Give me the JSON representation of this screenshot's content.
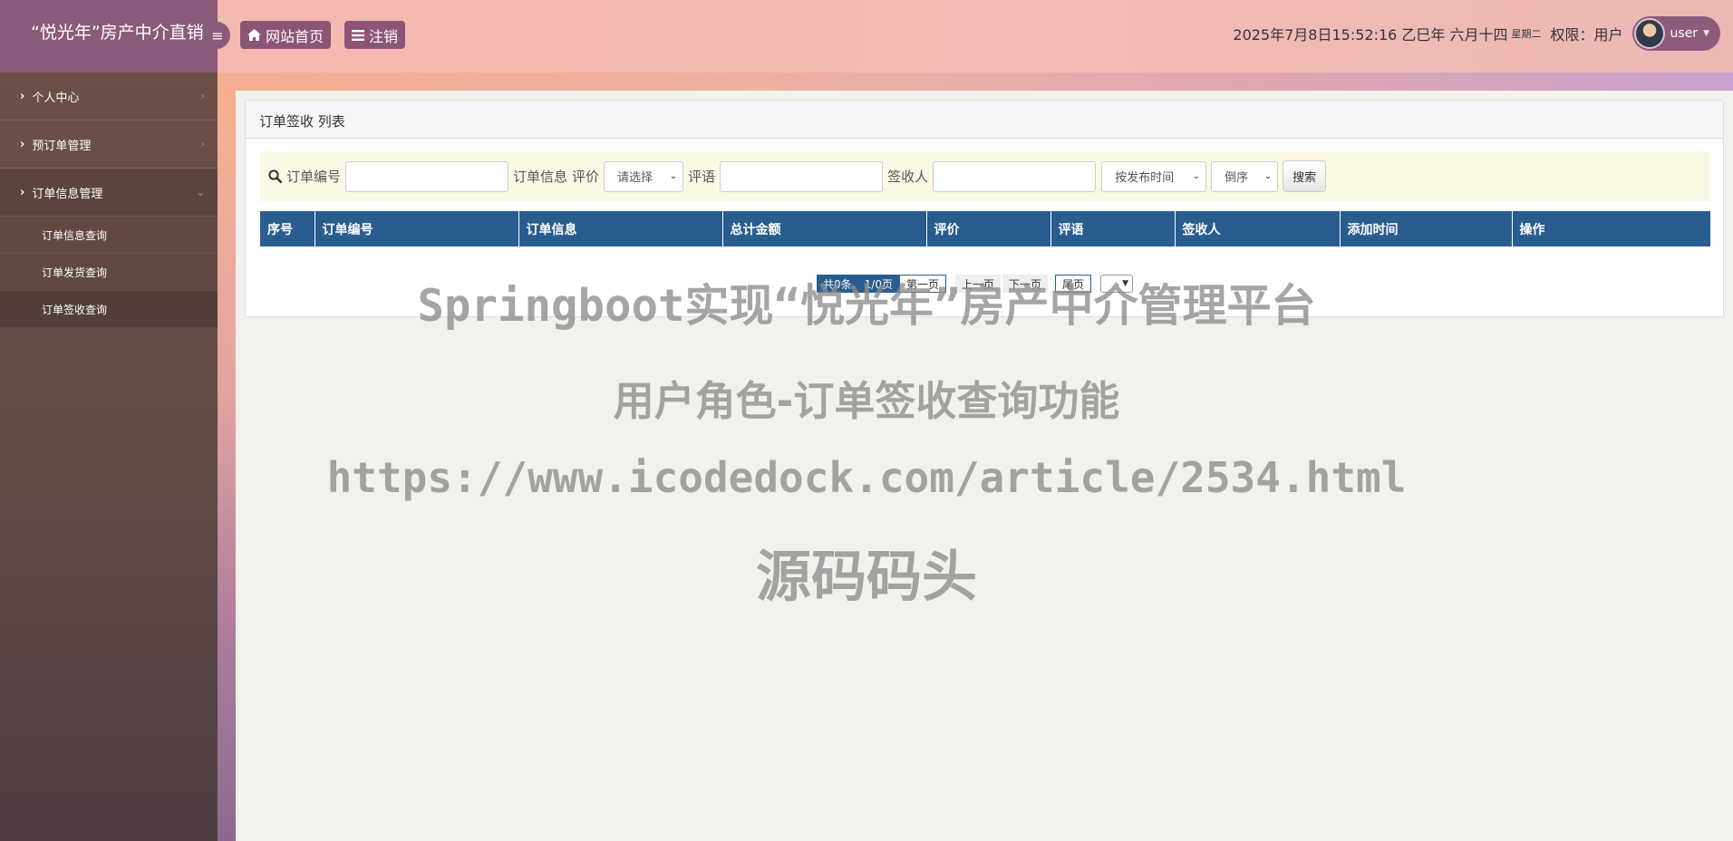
{
  "header": {
    "brand": "“悦光年”房产中介直销",
    "home_label": "网站首页",
    "logout_label": "注销",
    "datetime": "2025年7月8日15:52:16 乙巳年 六月十四",
    "weekday": "星期二",
    "permission": "权限：用户",
    "username": "user"
  },
  "sidebar": {
    "items": [
      {
        "label": "个人中心",
        "expanded": false
      },
      {
        "label": "预订单管理",
        "expanded": false
      },
      {
        "label": "订单信息管理",
        "expanded": true
      }
    ],
    "subitems": [
      {
        "label": "订单信息查询"
      },
      {
        "label": "订单发货查询"
      },
      {
        "label": "订单签收查询",
        "active": true
      }
    ]
  },
  "panel": {
    "title": "订单签收 列表"
  },
  "search": {
    "order_no_label": "订单编号",
    "order_info_label": "订单信息",
    "rating_label": "评价",
    "rating_value": "请选择",
    "comment_label": "评语",
    "signer_label": "签收人",
    "sort_field": "按发布时间",
    "sort_order": "倒序",
    "search_button": "搜索"
  },
  "table": {
    "columns": [
      "序号",
      "订单编号",
      "订单信息",
      "总计金额",
      "评价",
      "评语",
      "签收人",
      "添加时间",
      "操作"
    ],
    "rows": []
  },
  "pagination": {
    "total": "共0条",
    "page_info": "1/0页",
    "first": "第一页",
    "prev": "上一页",
    "next": "下一页",
    "last": "尾页"
  },
  "watermark": {
    "line1": "Springboot实现“悦光年”房产中介管理平台",
    "line2": "用户角色-订单签收查询功能",
    "line3": "https://www.icodedock.com/article/2534.html",
    "line4": "源码码头"
  }
}
